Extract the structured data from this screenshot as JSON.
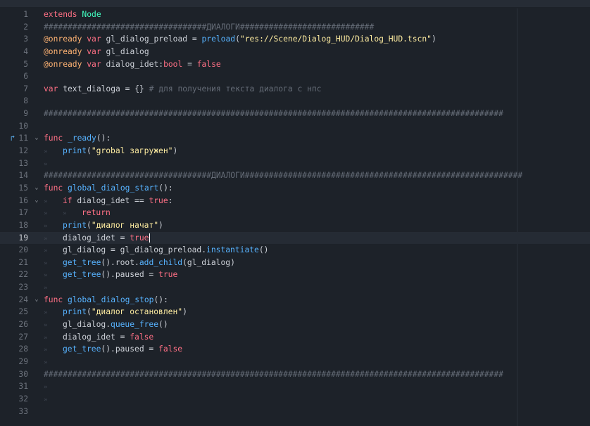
{
  "editor": {
    "current_line": 19,
    "tab_glyph": "»",
    "fold_glyph": "⌄",
    "breakpoint_glyph": "↱",
    "lines": [
      {
        "n": "1",
        "indent": 0,
        "tokens": [
          {
            "c": "kw",
            "t": "extends"
          },
          {
            "c": "pl",
            "t": " "
          },
          {
            "c": "ty",
            "t": "Node"
          }
        ]
      },
      {
        "n": "2",
        "indent": 0,
        "tokens": [
          {
            "c": "cm",
            "t": "##################################ДИАЛОГИ############################"
          }
        ]
      },
      {
        "n": "3",
        "indent": 0,
        "tokens": [
          {
            "c": "an",
            "t": "@onready"
          },
          {
            "c": "pl",
            "t": " "
          },
          {
            "c": "kw",
            "t": "var"
          },
          {
            "c": "pl",
            "t": " gl_dialog_preload = "
          },
          {
            "c": "fn",
            "t": "preload"
          },
          {
            "c": "pl",
            "t": "("
          },
          {
            "c": "st",
            "t": "\"res://Scene/Dialog_HUD/Dialog_HUD.tscn\""
          },
          {
            "c": "pl",
            "t": ")"
          }
        ]
      },
      {
        "n": "4",
        "indent": 0,
        "tokens": [
          {
            "c": "an",
            "t": "@onready"
          },
          {
            "c": "pl",
            "t": " "
          },
          {
            "c": "kw",
            "t": "var"
          },
          {
            "c": "pl",
            "t": " gl_dialog"
          }
        ]
      },
      {
        "n": "5",
        "indent": 0,
        "tokens": [
          {
            "c": "an",
            "t": "@onready"
          },
          {
            "c": "pl",
            "t": " "
          },
          {
            "c": "kw",
            "t": "var"
          },
          {
            "c": "pl",
            "t": " dialog_idet:"
          },
          {
            "c": "kw",
            "t": "bool"
          },
          {
            "c": "pl",
            "t": " = "
          },
          {
            "c": "kw",
            "t": "false"
          }
        ]
      },
      {
        "n": "6",
        "indent": 0,
        "tokens": []
      },
      {
        "n": "7",
        "indent": 0,
        "tokens": [
          {
            "c": "kw",
            "t": "var"
          },
          {
            "c": "pl",
            "t": " text_dialoga = {} "
          },
          {
            "c": "cm",
            "t": "# для получения текста диалога с нпс"
          }
        ]
      },
      {
        "n": "8",
        "indent": 0,
        "tokens": []
      },
      {
        "n": "9",
        "indent": 0,
        "tokens": [
          {
            "c": "cm",
            "t": "################################################################################################"
          }
        ]
      },
      {
        "n": "10",
        "indent": 0,
        "tokens": []
      },
      {
        "n": "11",
        "indent": 0,
        "mark": true,
        "fold": true,
        "tokens": [
          {
            "c": "kw",
            "t": "func"
          },
          {
            "c": "pl",
            "t": " "
          },
          {
            "c": "fn",
            "t": "_ready"
          },
          {
            "c": "pl",
            "t": "():"
          }
        ]
      },
      {
        "n": "12",
        "indent": 1,
        "tokens": [
          {
            "c": "fn",
            "t": "print"
          },
          {
            "c": "pl",
            "t": "("
          },
          {
            "c": "st",
            "t": "\"grobal загружен\""
          },
          {
            "c": "pl",
            "t": ")"
          }
        ]
      },
      {
        "n": "13",
        "indent": 1,
        "tokens": []
      },
      {
        "n": "14",
        "indent": 0,
        "tokens": [
          {
            "c": "cm",
            "t": "###################################ДИАЛОГИ##########################################################"
          }
        ]
      },
      {
        "n": "15",
        "indent": 0,
        "fold": true,
        "tokens": [
          {
            "c": "kw",
            "t": "func"
          },
          {
            "c": "pl",
            "t": " "
          },
          {
            "c": "fn",
            "t": "global_dialog_start"
          },
          {
            "c": "pl",
            "t": "():"
          }
        ]
      },
      {
        "n": "16",
        "indent": 1,
        "fold": true,
        "tokens": [
          {
            "c": "kw",
            "t": "if"
          },
          {
            "c": "pl",
            "t": " dialog_idet == "
          },
          {
            "c": "kw",
            "t": "true"
          },
          {
            "c": "pl",
            "t": ":"
          }
        ]
      },
      {
        "n": "17",
        "indent": 2,
        "tokens": [
          {
            "c": "kw",
            "t": "return"
          }
        ]
      },
      {
        "n": "18",
        "indent": 1,
        "tokens": [
          {
            "c": "fn",
            "t": "print"
          },
          {
            "c": "pl",
            "t": "("
          },
          {
            "c": "st",
            "t": "\"диалог начат\""
          },
          {
            "c": "pl",
            "t": ")"
          }
        ]
      },
      {
        "n": "19",
        "indent": 1,
        "caret": true,
        "tokens": [
          {
            "c": "pl",
            "t": "dialog_idet = "
          },
          {
            "c": "kw",
            "t": "true"
          }
        ]
      },
      {
        "n": "20",
        "indent": 1,
        "tokens": [
          {
            "c": "pl",
            "t": "gl_dialog = gl_dialog_preload."
          },
          {
            "c": "fn",
            "t": "instantiate"
          },
          {
            "c": "pl",
            "t": "()"
          }
        ]
      },
      {
        "n": "21",
        "indent": 1,
        "tokens": [
          {
            "c": "fn",
            "t": "get_tree"
          },
          {
            "c": "pl",
            "t": "().root."
          },
          {
            "c": "fn",
            "t": "add_child"
          },
          {
            "c": "pl",
            "t": "(gl_dialog)"
          }
        ]
      },
      {
        "n": "22",
        "indent": 1,
        "tokens": [
          {
            "c": "fn",
            "t": "get_tree"
          },
          {
            "c": "pl",
            "t": "().paused = "
          },
          {
            "c": "kw",
            "t": "true"
          }
        ]
      },
      {
        "n": "23",
        "indent": 1,
        "tokens": []
      },
      {
        "n": "24",
        "indent": 0,
        "fold": true,
        "tokens": [
          {
            "c": "kw",
            "t": "func"
          },
          {
            "c": "pl",
            "t": " "
          },
          {
            "c": "fn",
            "t": "global_dialog_stop"
          },
          {
            "c": "pl",
            "t": "():"
          }
        ]
      },
      {
        "n": "25",
        "indent": 1,
        "tokens": [
          {
            "c": "fn",
            "t": "print"
          },
          {
            "c": "pl",
            "t": "("
          },
          {
            "c": "st",
            "t": "\"диалог остановлен\""
          },
          {
            "c": "pl",
            "t": ")"
          }
        ]
      },
      {
        "n": "26",
        "indent": 1,
        "tokens": [
          {
            "c": "pl",
            "t": "gl_dialog."
          },
          {
            "c": "fn",
            "t": "queue_free"
          },
          {
            "c": "pl",
            "t": "()"
          }
        ]
      },
      {
        "n": "27",
        "indent": 1,
        "tokens": [
          {
            "c": "pl",
            "t": "dialog_idet = "
          },
          {
            "c": "kw",
            "t": "false"
          }
        ]
      },
      {
        "n": "28",
        "indent": 1,
        "tokens": [
          {
            "c": "fn",
            "t": "get_tree"
          },
          {
            "c": "pl",
            "t": "().paused = "
          },
          {
            "c": "kw",
            "t": "false"
          }
        ]
      },
      {
        "n": "29",
        "indent": 1,
        "tokens": []
      },
      {
        "n": "30",
        "indent": 0,
        "tokens": [
          {
            "c": "cm",
            "t": "################################################################################################"
          }
        ]
      },
      {
        "n": "31",
        "indent": 1,
        "tokens": []
      },
      {
        "n": "32",
        "indent": 1,
        "tokens": []
      },
      {
        "n": "33",
        "indent": 0,
        "tokens": []
      }
    ]
  }
}
